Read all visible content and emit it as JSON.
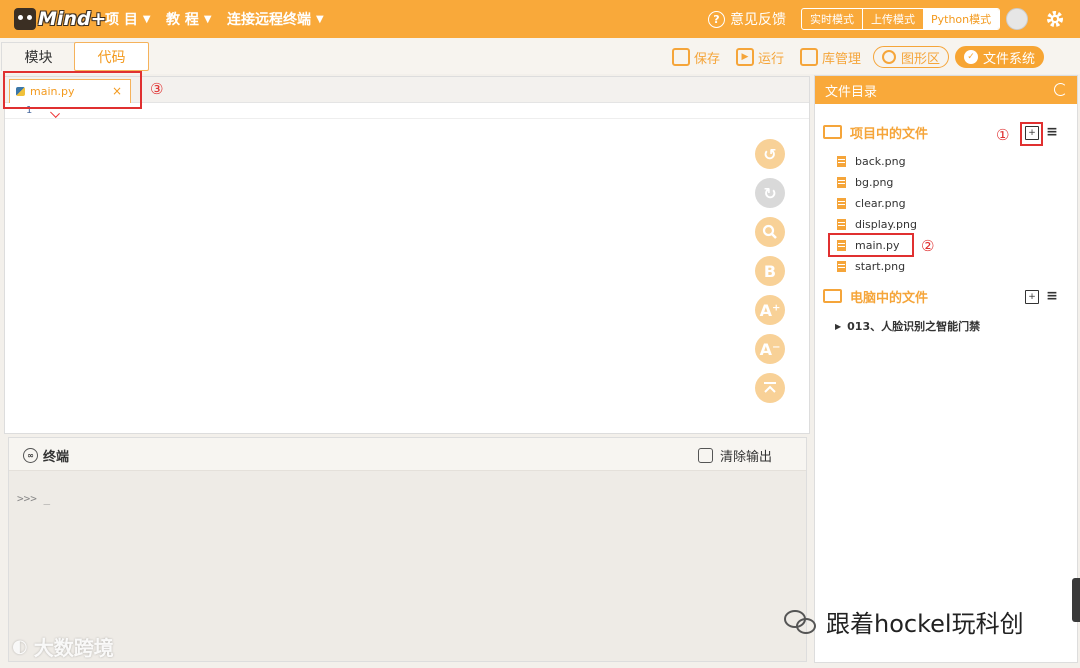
{
  "app": {
    "brand": "Mind+"
  },
  "topbar": {
    "menus": [
      {
        "label": "项 目"
      },
      {
        "label": "教 程"
      },
      {
        "label": "连接远程终端"
      }
    ],
    "feedback": "意见反馈",
    "modes": [
      "实时模式",
      "上传模式",
      "Python模式"
    ],
    "active_mode": "Python模式"
  },
  "subbar": {
    "tabs": [
      "模块",
      "代码"
    ],
    "active_tab": "代码",
    "tools": {
      "save": "保存",
      "run": "运行",
      "libs": "库管理",
      "graphics": "图形区",
      "filesystem": "文件系统"
    }
  },
  "editor": {
    "open_file": "main.py",
    "line_numbers": [
      "1"
    ],
    "side_buttons": [
      "undo-icon",
      "redo-icon",
      "search-icon",
      "bold-icon",
      "font-increase-icon",
      "font-decrease-icon",
      "to-top-icon"
    ],
    "side_labels": {
      "bold": "B",
      "inc": "A⁺",
      "dec": "A⁻"
    }
  },
  "terminal": {
    "title": "终端",
    "clear": "清除输出",
    "prompt": ">>> _"
  },
  "files_panel": {
    "title": "文件目录",
    "project_section": "项目中的文件",
    "project_files": [
      "back.png",
      "bg.png",
      "clear.png",
      "display.png",
      "main.py",
      "start.png"
    ],
    "pc_section": "电脑中的文件",
    "pc_folder": "013、人脸识别之智能门禁"
  },
  "annotations": [
    "①",
    "②",
    "③"
  ],
  "watermarks": {
    "left": "大数跨境",
    "right": "跟着hockel玩科创"
  },
  "colors": {
    "brand_orange": "#f9a93a",
    "annotation_red": "#e03030"
  }
}
